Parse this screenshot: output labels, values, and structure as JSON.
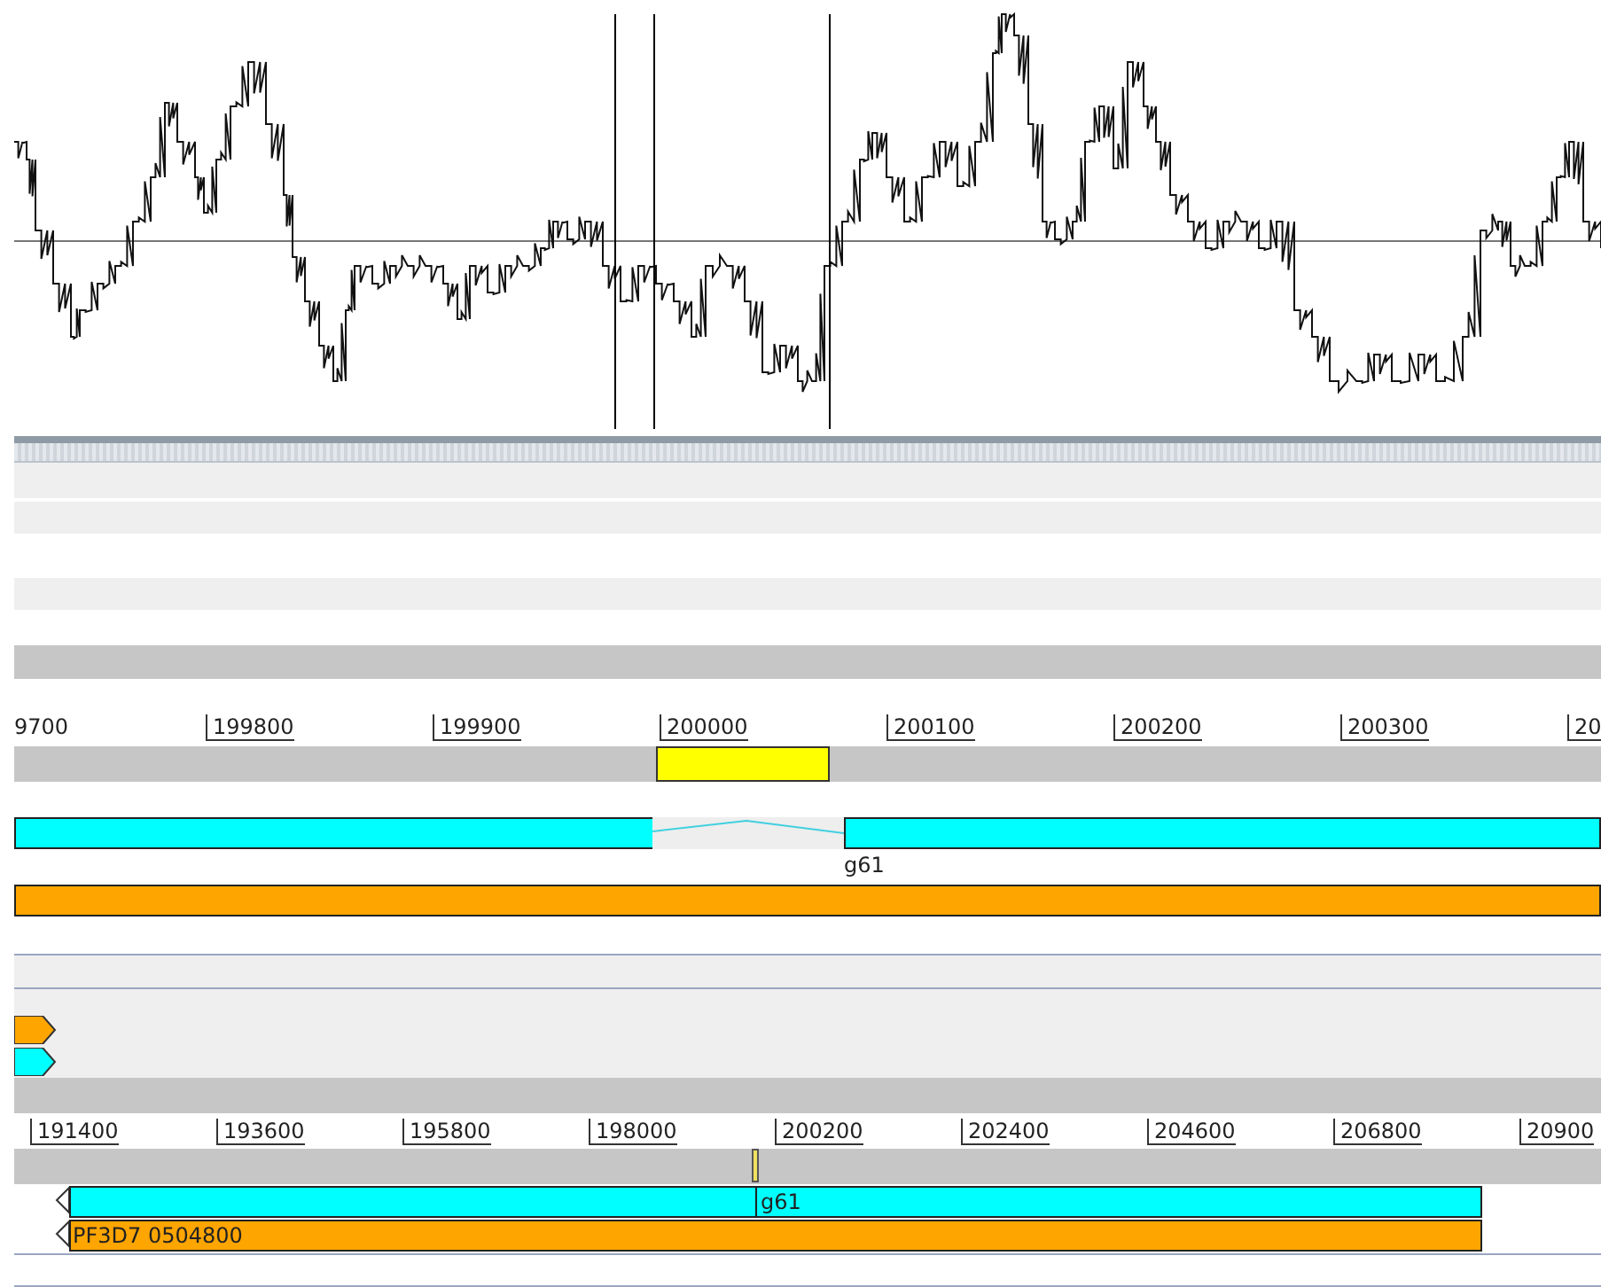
{
  "detail_view": {
    "ruler_ticks": [
      "9700",
      "199800",
      "199900",
      "200000",
      "200100",
      "200200",
      "200300",
      "20"
    ],
    "features": [
      {
        "kind": "split",
        "label": "g61",
        "color": "#00ffff"
      },
      {
        "kind": "bar",
        "color": "#ffa500"
      }
    ]
  },
  "strand_marks": [
    {
      "color": "#ffa500"
    },
    {
      "color": "#00ffff"
    }
  ],
  "overview": {
    "ruler_ticks": [
      "191400",
      "193600",
      "195800",
      "198000",
      "200200",
      "202400",
      "204600",
      "206800",
      "20900"
    ],
    "features": [
      {
        "label": "g61",
        "color": "#00ffff"
      },
      {
        "label": "PF3D7 0504800",
        "color": "#ffa500"
      }
    ]
  }
}
